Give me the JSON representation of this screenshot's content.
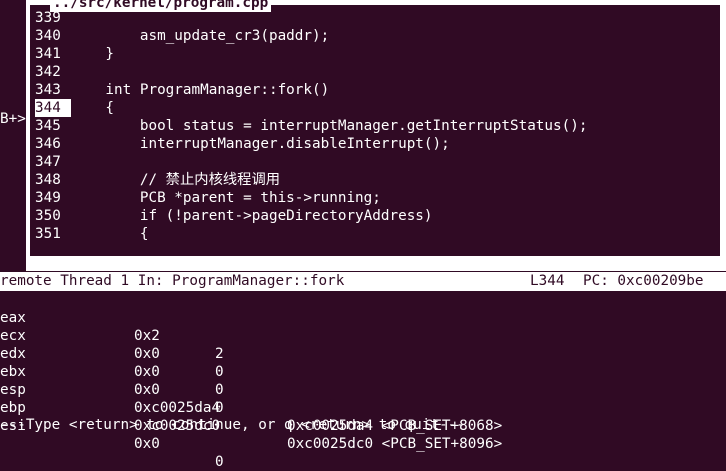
{
  "source_window": {
    "title": "../src/kernel/program.cpp",
    "breakpoint_marker": "B+>",
    "current_line": "344",
    "lines": [
      {
        "no": "339",
        "text": ""
      },
      {
        "no": "340",
        "text": "        asm_update_cr3(paddr);"
      },
      {
        "no": "341",
        "text": "    }"
      },
      {
        "no": "342",
        "text": ""
      },
      {
        "no": "343",
        "text": "    int ProgramManager::fork()"
      },
      {
        "no": "344",
        "text": "    {"
      },
      {
        "no": "345",
        "text": "        bool status = interruptManager.getInterruptStatus();"
      },
      {
        "no": "346",
        "text": "        interruptManager.disableInterrupt();"
      },
      {
        "no": "347",
        "text": ""
      },
      {
        "no": "348",
        "text": "        // 禁止内核线程调用"
      },
      {
        "no": "349",
        "text": "        PCB *parent = this->running;"
      },
      {
        "no": "350",
        "text": "        if (!parent->pageDirectoryAddress)"
      },
      {
        "no": "351",
        "text": "        {"
      }
    ]
  },
  "status_bar": {
    "target": "remote Thread 1 In: ProgramManager::fork",
    "line": "L344",
    "pc": "PC: 0xc00209be"
  },
  "registers": [
    {
      "name": "eax",
      "hex": "0x2",
      "natural": "2"
    },
    {
      "name": "ecx",
      "hex": "0x0",
      "natural": "0"
    },
    {
      "name": "edx",
      "hex": "0x0",
      "natural": "0"
    },
    {
      "name": "ebx",
      "hex": "0x0",
      "natural": "0"
    },
    {
      "name": "esp",
      "hex": "0xc0025da4",
      "natural": "0xc0025da4 <PCB_SET+8068>"
    },
    {
      "name": "ebp",
      "hex": "0xc0025dc0",
      "natural": "0xc0025dc0 <PCB_SET+8096>"
    },
    {
      "name": "esi",
      "hex": "0x0",
      "natural": "0"
    }
  ],
  "pager_prompt": "---Type <return> to continue, or q <return> to quit---",
  "colors": {
    "terminal_bg": "#300a24",
    "terminal_fg": "#ffffff",
    "frame": "#ffffff"
  }
}
